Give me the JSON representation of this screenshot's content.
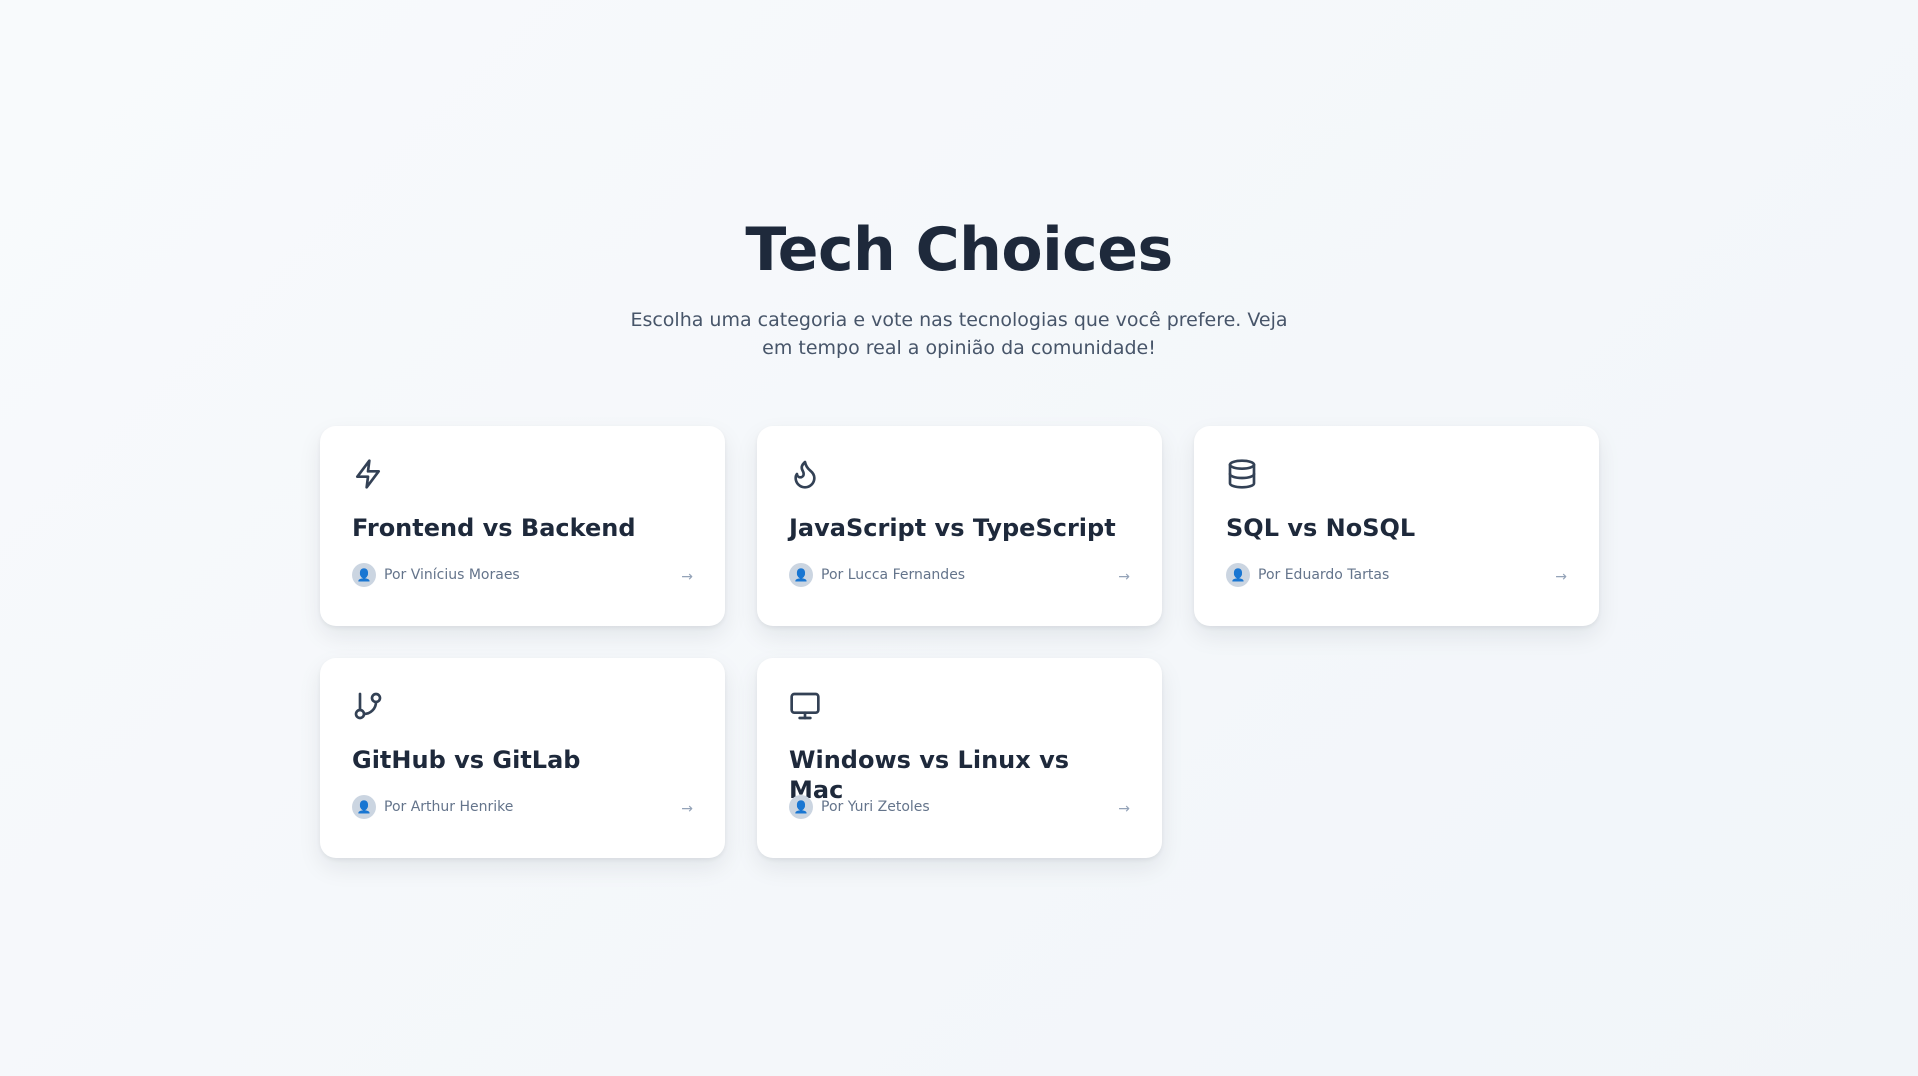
{
  "header": {
    "title": "Tech Choices",
    "subtitle": "Escolha uma categoria e vote nas tecnologias que você prefere. Veja em tempo real a opinião da comunidade!"
  },
  "cards": [
    {
      "icon": "lightning-icon",
      "title": "Frontend vs Backend",
      "author": "Por Vinícius Moraes",
      "arrow": "→"
    },
    {
      "icon": "flame-icon",
      "title": "JavaScript vs TypeScript",
      "author": "Por Lucca Fernandes",
      "arrow": "→"
    },
    {
      "icon": "database-icon",
      "title": "SQL vs NoSQL",
      "author": "Por Eduardo Tartas",
      "arrow": "→"
    },
    {
      "icon": "git-branch-icon",
      "title": "GitHub vs GitLab",
      "author": "Por Arthur Henrike",
      "arrow": "→"
    },
    {
      "icon": "monitor-icon",
      "title": "Windows vs Linux vs Mac",
      "author": "Por Yuri Zetoles",
      "arrow": "→"
    }
  ],
  "avatar_glyph": "👤",
  "colors": {
    "background": "#f8fafc",
    "text_primary": "#1e293b",
    "text_secondary": "#475569",
    "muted": "#64748b",
    "avatar_bg": "#cbd5e1",
    "avatar_accent": "#3b82f6"
  }
}
